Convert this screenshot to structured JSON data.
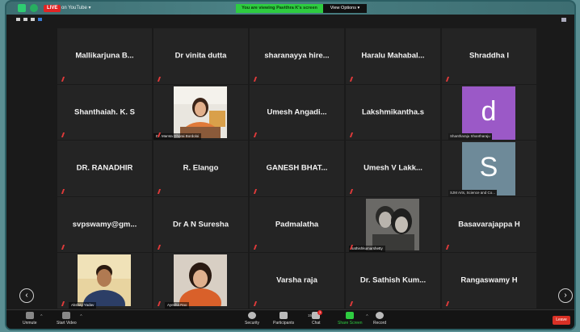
{
  "header": {
    "live_label": "LIVE",
    "live_platform": "on YouTube",
    "viewing_banner": "You are viewing Pavithra K's screen",
    "view_options": "View Options"
  },
  "colors": {
    "live_red": "#e02424",
    "banner_green": "#2ecc40",
    "tile_bg": "#242424",
    "avatar_purple": "#9b59c7",
    "avatar_slate": "#6e8a99",
    "leave_red": "#d93025"
  },
  "participants": {
    "r1": [
      "Mallikarjuna B...",
      "Dr vinita dutta",
      "sharanayya hire...",
      "Haralu Mahabal...",
      "Shraddha I"
    ],
    "r2": {
      "c1": "Shanthaiah. K. S",
      "c2_label": "Dr. Mamta Ghorai Bordoloi",
      "c3": "Umesh Angadi...",
      "c4": "Lakshmikantha.s",
      "c5_letter": "d",
      "c5_label": "Shantharaju Shantharaju"
    },
    "r3": {
      "c1": "DR. RANADHIR",
      "c2": "R. Elango",
      "c3": "GANESH BHAT...",
      "c4": "Umesh V Lakk...",
      "c5_letter": "S",
      "c5_label": "SJM Arts, Science and Co..."
    },
    "r4": {
      "c1": "svpswamy@gm...",
      "c2": "Dr A N Suresha",
      "c3": "Padmalatha",
      "c4_label": "sathishkumarshetty",
      "c5": "Basavarajappa H"
    },
    "r5": {
      "c1_label": "Akshay Yadav",
      "c2_label": "Ayesha Rao",
      "c3": "Varsha raja",
      "c4": "Dr. Sathish Kum...",
      "c5": "Rangaswamy H"
    }
  },
  "nav": {
    "prev": "‹",
    "next": "›"
  },
  "toolbar": {
    "unmute": "Unmute",
    "start_video": "Start Video",
    "security": "Security",
    "participants": "Participants",
    "participants_count": "154",
    "chat": "Chat",
    "chat_badge": "3",
    "share_screen": "Share Screen",
    "record": "Record",
    "leave": "Leave"
  }
}
